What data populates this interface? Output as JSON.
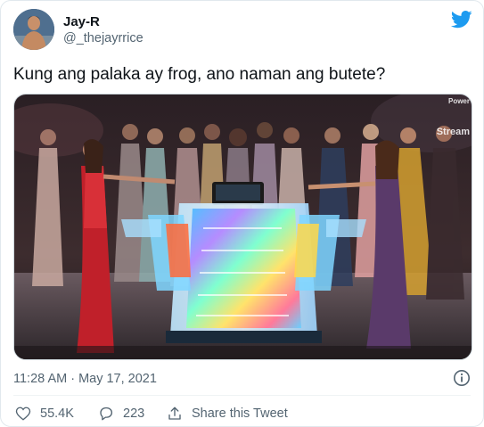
{
  "user": {
    "display_name": "Jay-R",
    "handle": "@_thejayrrice",
    "avatar_icon": "profile-photo"
  },
  "tweet": {
    "text": "Kung ang palaka ay frog, ano naman ang butete?",
    "timestamp": "11:28 AM · May 17, 2021"
  },
  "media": {
    "overlay_power": "Power",
    "overlay_stream": "Stream",
    "alt": "Pageant stage photo of contestants in gowns gesturing toward a glowing rainbow crown display pedestal"
  },
  "actions": {
    "likes": "55.4K",
    "replies": "223",
    "share_label": "Share this Tweet"
  },
  "icons": {
    "brand": "twitter-bird-icon",
    "info": "info-icon",
    "like": "heart-icon",
    "reply": "reply-bubble-icon",
    "share": "share-arrow-icon"
  },
  "colors": {
    "brand_blue": "#1d9bf0",
    "secondary_text": "#536471",
    "primary_text": "#0f1419"
  }
}
